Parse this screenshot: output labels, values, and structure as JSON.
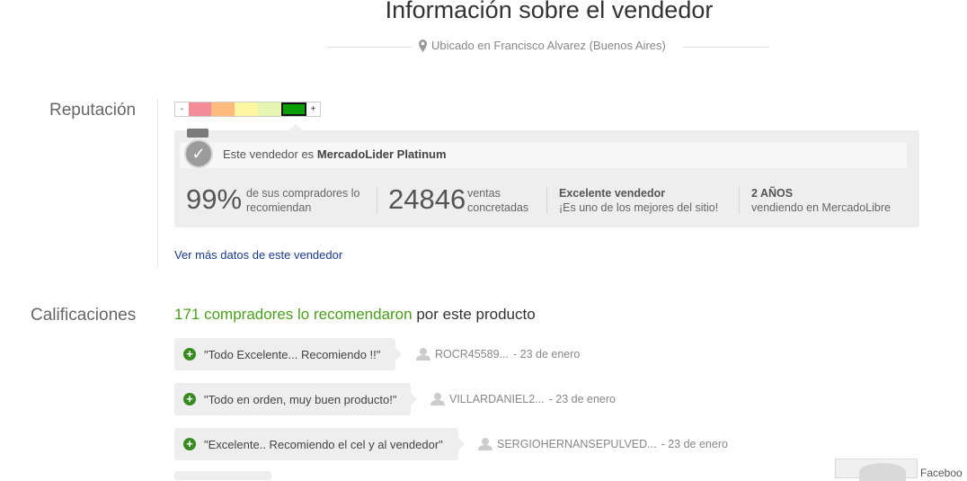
{
  "header": {
    "title": "Información sobre el vendedor",
    "location": "Ubicado en Francisco Alvarez (Buenos Aires)"
  },
  "reputation": {
    "label": "Reputación",
    "thermometer": {
      "minus": "-",
      "plus": "+",
      "levels": 5,
      "active_level": 5
    },
    "mercadolider_prefix": "Este vendedor es",
    "mercadolider_level": "MercadoLider Platinum",
    "stats": [
      {
        "big": "99%",
        "line1": "de sus compradores lo",
        "line2": "recomiendan"
      },
      {
        "big": "24846",
        "line1": "ventas",
        "line2": "concretadas"
      },
      {
        "bold": "Excelente vendedor",
        "line2": "¡Es uno de los mejores del sitio!"
      },
      {
        "bold": "2 AÑOS",
        "line2": "vendiendo en MercadoLibre"
      }
    ],
    "more_link": "Ver más datos de este vendedor"
  },
  "ratings": {
    "label": "Calificaciones",
    "summary_highlight": "171 compradores lo recomendaron",
    "summary_rest": "por este producto",
    "items": [
      {
        "comment": "\"Todo Excelente... Recomiendo !!\"",
        "user": "ROCR45589...",
        "date": "- 23 de enero"
      },
      {
        "comment": "\"Todo en orden, muy buen producto!\"",
        "user": "VILLARDANIEL2...",
        "date": "- 23 de enero"
      },
      {
        "comment": "\"Excelente.. Recomiendo el cel y al vendedor\"",
        "user": "SERGIOHERNANSEPULVED...",
        "date": "- 23 de enero"
      }
    ]
  },
  "facebook": {
    "label": "Faceboo"
  },
  "colors": {
    "thermometer": [
      "#f28c98",
      "#fdbb7e",
      "#fdf7a3",
      "#e6f5b0",
      "#0a9d00"
    ],
    "recommend_green": "#4a9e1e",
    "link_blue": "#1a3a8c",
    "plus_green": "#3a8a22"
  }
}
